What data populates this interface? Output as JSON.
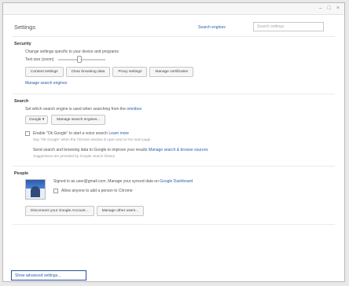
{
  "window": {
    "controls": [
      "–",
      "□",
      "×"
    ]
  },
  "header": {
    "title": "Settings",
    "search_engines_link": "Search engines",
    "search_placeholder": "Search settings"
  },
  "privacy": {
    "title": "Security",
    "description": "Change settings specific to your device and programs",
    "zoom_label": "Text size (zoom)",
    "slider_level": 0.45,
    "buttons": [
      "Content settings",
      "Clear browsing data",
      "Proxy settings",
      "Manage certificates"
    ],
    "link": "Manage search engines"
  },
  "search": {
    "title": "Search",
    "description": "Set which search engine is used when searching from the",
    "description_link": "omnibox",
    "engine_value": "Google",
    "manage_button": "Manage search engines...",
    "check1_label": "Enable \"Ok Google\" to start a voice search",
    "check1_link": "Learn more",
    "check1_sub": "Say \"Ok Google\" when the Chrome window is open and on the start page",
    "check2_label": "Send search and browsing data to Google to improve your results",
    "check2_link": "Manage search & browse sources",
    "check2_sub": "Suggestions are provided by Google search history"
  },
  "people": {
    "title": "People",
    "description": "Signed in as user@gmail.com. Manage your synced data on",
    "description_link": "Google Dashboard",
    "checkbox_label": "Allow anyone to add a person to Chrome",
    "buttons": [
      "Disconnect your Google Account...",
      "Manage other users..."
    ]
  },
  "advanced_link": "Show advanced settings..."
}
